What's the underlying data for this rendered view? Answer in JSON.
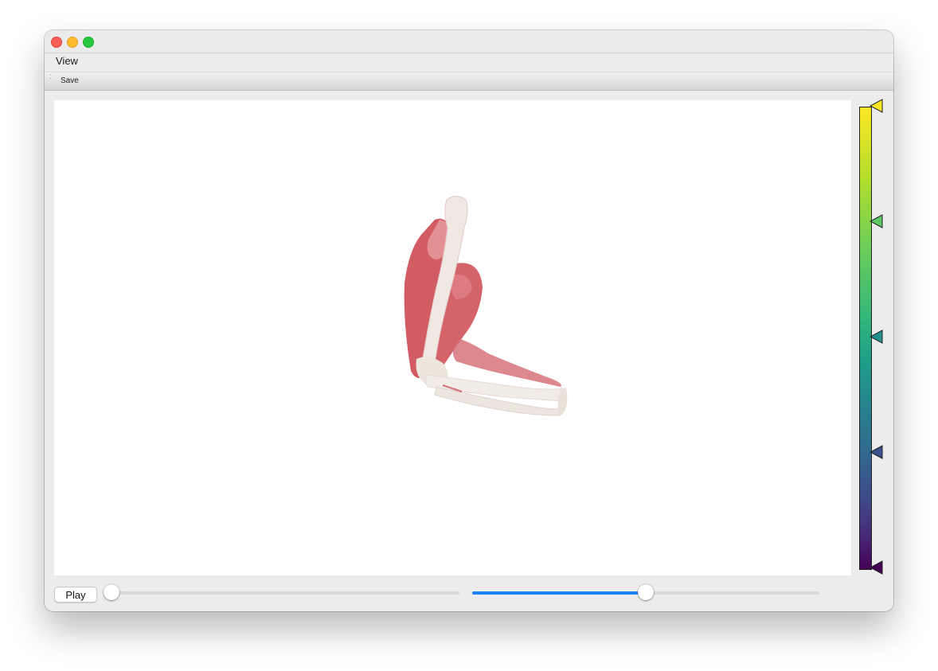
{
  "window": {
    "controls": [
      "close",
      "minimize",
      "zoom"
    ]
  },
  "menubar": {
    "items": [
      {
        "label": "View"
      }
    ]
  },
  "toolbar": {
    "save_label": "Save"
  },
  "viewport": {
    "content": "3d-arm-muscle-model",
    "background": "#ffffff"
  },
  "colorbar": {
    "colormap": "viridis",
    "handles": 5
  },
  "controls": {
    "play_label": "Play",
    "frame_slider_value": 0.0,
    "second_slider_value": 0.5
  },
  "colors": {
    "accent": "#1a84f6",
    "muscle": "#d8696e",
    "bone": "#f1ece4"
  }
}
